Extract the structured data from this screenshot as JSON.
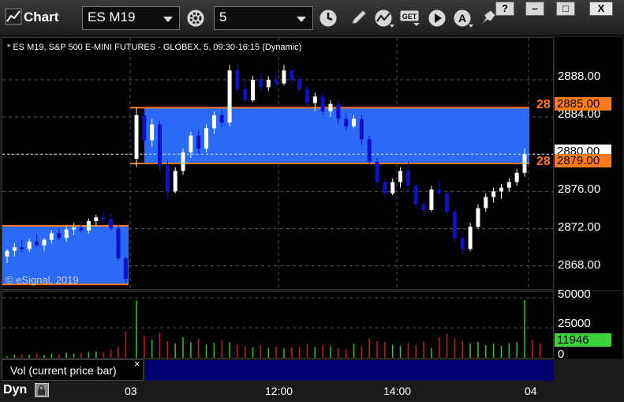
{
  "window": {
    "title": "Chart",
    "symbol": "ES M19",
    "interval": "5",
    "buttons": [
      "?",
      "–",
      "□",
      "X"
    ]
  },
  "chart": {
    "header": "* ES M19, S&P 500 E-MINI FUTURES - GLOBEX, 5, 09:30-16:15 (Dynamic)",
    "copyright": "© eSignal, 2019",
    "price_ticks": [
      "2888.00",
      "2884.00",
      "2880.00",
      "2876.00",
      "2872.00",
      "2868.00"
    ],
    "tags": {
      "upper_level": "2885.00",
      "last_price": "2880.00",
      "lower_level": "2879.00",
      "upper_partial": "28",
      "lower_partial": "28"
    },
    "volume_ticks": [
      "50000",
      "25000",
      "0"
    ],
    "volume_tag": "11946",
    "volume_label": "Vol (current price bar)",
    "close_x": "×",
    "time_ticks": [
      "03",
      "12:00",
      "14:00",
      "04"
    ],
    "mode": "Dyn",
    "colors": {
      "zone": "#2a6af5",
      "level": "#ff7a1a",
      "up": "#ffffff",
      "down": "#1010c8",
      "vol_up": "#2cc92c",
      "vol_down": "#c81e1e"
    },
    "chart_data": {
      "type": "candlestick",
      "title": "* ES M19, S&P 500 E-MINI FUTURES - GLOBEX, 5, 09:30-16:15 (Dynamic)",
      "ylim": [
        2865.5,
        2892.5
      ],
      "zones": [
        {
          "low": 2866.0,
          "high": 2872.3
        },
        {
          "low": 2879.0,
          "high": 2885.0
        }
      ],
      "last_price": 2880.0,
      "candles": [
        {
          "o": 2869.0,
          "h": 2869.8,
          "l": 2868.3,
          "c": 2869.6
        },
        {
          "o": 2869.6,
          "h": 2870.4,
          "l": 2869.0,
          "c": 2870.0
        },
        {
          "o": 2870.0,
          "h": 2870.8,
          "l": 2869.4,
          "c": 2869.8
        },
        {
          "o": 2869.8,
          "h": 2870.9,
          "l": 2869.5,
          "c": 2870.6
        },
        {
          "o": 2870.6,
          "h": 2871.4,
          "l": 2870.0,
          "c": 2870.2
        },
        {
          "o": 2870.2,
          "h": 2871.0,
          "l": 2869.6,
          "c": 2870.8
        },
        {
          "o": 2870.8,
          "h": 2871.8,
          "l": 2870.4,
          "c": 2871.5
        },
        {
          "o": 2871.5,
          "h": 2872.0,
          "l": 2870.8,
          "c": 2871.0
        },
        {
          "o": 2871.0,
          "h": 2872.2,
          "l": 2870.6,
          "c": 2871.9
        },
        {
          "o": 2871.9,
          "h": 2872.6,
          "l": 2871.3,
          "c": 2872.1
        },
        {
          "o": 2872.1,
          "h": 2872.7,
          "l": 2871.6,
          "c": 2871.8
        },
        {
          "o": 2871.8,
          "h": 2873.1,
          "l": 2871.5,
          "c": 2872.8
        },
        {
          "o": 2872.8,
          "h": 2873.5,
          "l": 2872.2,
          "c": 2873.2
        },
        {
          "o": 2873.2,
          "h": 2873.8,
          "l": 2872.6,
          "c": 2873.0
        },
        {
          "o": 2873.0,
          "h": 2873.6,
          "l": 2871.8,
          "c": 2872.0
        },
        {
          "o": 2872.0,
          "h": 2872.4,
          "l": 2868.5,
          "c": 2868.8
        },
        {
          "o": 2868.8,
          "h": 2869.0,
          "l": 2866.2,
          "c": 2866.6
        },
        {
          "o": 2879.5,
          "h": 2885.0,
          "l": 2878.6,
          "c": 2884.2
        },
        {
          "o": 2884.2,
          "h": 2884.6,
          "l": 2881.0,
          "c": 2881.5
        },
        {
          "o": 2881.5,
          "h": 2883.8,
          "l": 2880.8,
          "c": 2883.2
        },
        {
          "o": 2883.2,
          "h": 2883.6,
          "l": 2878.2,
          "c": 2878.8
        },
        {
          "o": 2878.8,
          "h": 2879.4,
          "l": 2875.2,
          "c": 2876.0
        },
        {
          "o": 2876.0,
          "h": 2878.6,
          "l": 2875.8,
          "c": 2878.2
        },
        {
          "o": 2878.2,
          "h": 2880.6,
          "l": 2877.8,
          "c": 2880.2
        },
        {
          "o": 2880.2,
          "h": 2882.4,
          "l": 2879.6,
          "c": 2882.0
        },
        {
          "o": 2882.0,
          "h": 2882.6,
          "l": 2880.0,
          "c": 2880.6
        },
        {
          "o": 2880.6,
          "h": 2883.2,
          "l": 2880.2,
          "c": 2882.8
        },
        {
          "o": 2882.8,
          "h": 2884.6,
          "l": 2882.2,
          "c": 2884.2
        },
        {
          "o": 2884.2,
          "h": 2884.8,
          "l": 2883.0,
          "c": 2883.4
        },
        {
          "o": 2883.4,
          "h": 2889.6,
          "l": 2883.0,
          "c": 2889.0
        },
        {
          "o": 2889.0,
          "h": 2889.8,
          "l": 2886.6,
          "c": 2887.0
        },
        {
          "o": 2887.0,
          "h": 2887.8,
          "l": 2885.4,
          "c": 2885.8
        },
        {
          "o": 2885.8,
          "h": 2888.4,
          "l": 2885.6,
          "c": 2888.0
        },
        {
          "o": 2888.0,
          "h": 2888.6,
          "l": 2886.8,
          "c": 2887.2
        },
        {
          "o": 2887.2,
          "h": 2888.4,
          "l": 2886.8,
          "c": 2888.0
        },
        {
          "o": 2888.0,
          "h": 2888.8,
          "l": 2887.2,
          "c": 2887.6
        },
        {
          "o": 2887.6,
          "h": 2889.6,
          "l": 2887.4,
          "c": 2889.0
        },
        {
          "o": 2889.0,
          "h": 2889.4,
          "l": 2887.6,
          "c": 2888.0
        },
        {
          "o": 2888.0,
          "h": 2888.4,
          "l": 2886.6,
          "c": 2887.0
        },
        {
          "o": 2887.0,
          "h": 2887.4,
          "l": 2885.0,
          "c": 2885.5
        },
        {
          "o": 2885.5,
          "h": 2886.6,
          "l": 2884.6,
          "c": 2886.2
        },
        {
          "o": 2886.2,
          "h": 2886.8,
          "l": 2884.2,
          "c": 2884.6
        },
        {
          "o": 2884.6,
          "h": 2885.8,
          "l": 2884.0,
          "c": 2885.4
        },
        {
          "o": 2885.4,
          "h": 2885.8,
          "l": 2883.2,
          "c": 2883.8
        },
        {
          "o": 2883.8,
          "h": 2884.4,
          "l": 2882.6,
          "c": 2883.0
        },
        {
          "o": 2883.0,
          "h": 2884.2,
          "l": 2882.8,
          "c": 2883.8
        },
        {
          "o": 2883.8,
          "h": 2884.2,
          "l": 2881.0,
          "c": 2881.6
        },
        {
          "o": 2881.6,
          "h": 2882.0,
          "l": 2878.8,
          "c": 2879.2
        },
        {
          "o": 2879.2,
          "h": 2879.6,
          "l": 2876.4,
          "c": 2877.0
        },
        {
          "o": 2877.0,
          "h": 2877.4,
          "l": 2875.2,
          "c": 2875.8
        },
        {
          "o": 2875.8,
          "h": 2877.4,
          "l": 2875.6,
          "c": 2877.0
        },
        {
          "o": 2877.0,
          "h": 2878.6,
          "l": 2876.4,
          "c": 2878.2
        },
        {
          "o": 2878.2,
          "h": 2879.2,
          "l": 2876.0,
          "c": 2876.6
        },
        {
          "o": 2876.6,
          "h": 2877.0,
          "l": 2874.2,
          "c": 2874.6
        },
        {
          "o": 2874.6,
          "h": 2875.2,
          "l": 2873.4,
          "c": 2874.0
        },
        {
          "o": 2874.0,
          "h": 2876.6,
          "l": 2873.8,
          "c": 2876.2
        },
        {
          "o": 2876.2,
          "h": 2877.2,
          "l": 2875.4,
          "c": 2875.8
        },
        {
          "o": 2875.8,
          "h": 2876.2,
          "l": 2873.4,
          "c": 2873.8
        },
        {
          "o": 2873.8,
          "h": 2874.2,
          "l": 2870.6,
          "c": 2871.0
        },
        {
          "o": 2871.0,
          "h": 2871.6,
          "l": 2869.2,
          "c": 2869.8
        },
        {
          "o": 2869.8,
          "h": 2872.6,
          "l": 2869.6,
          "c": 2872.2
        },
        {
          "o": 2872.2,
          "h": 2874.6,
          "l": 2872.0,
          "c": 2874.2
        },
        {
          "o": 2874.2,
          "h": 2875.8,
          "l": 2873.8,
          "c": 2875.4
        },
        {
          "o": 2875.4,
          "h": 2876.4,
          "l": 2874.8,
          "c": 2876.0
        },
        {
          "o": 2876.0,
          "h": 2876.8,
          "l": 2875.2,
          "c": 2876.4
        },
        {
          "o": 2876.4,
          "h": 2877.4,
          "l": 2876.0,
          "c": 2877.0
        },
        {
          "o": 2877.0,
          "h": 2878.4,
          "l": 2876.6,
          "c": 2878.0
        },
        {
          "o": 2878.0,
          "h": 2880.6,
          "l": 2877.6,
          "c": 2880.0
        }
      ],
      "volume": [
        1200,
        2500,
        3000,
        2400,
        3800,
        2200,
        3500,
        2800,
        4200,
        3600,
        3900,
        4800,
        5200,
        4500,
        6800,
        9500,
        22000,
        48000,
        18000,
        15000,
        21000,
        14000,
        12000,
        17000,
        13000,
        16000,
        11000,
        12500,
        14500,
        13000,
        11000,
        9800,
        8800,
        10500,
        8200,
        9200,
        7800,
        8500,
        9200,
        11000,
        8900,
        10800,
        9600,
        8000,
        7200,
        11800,
        9500,
        16000,
        14000,
        13000,
        11000,
        9800,
        12500,
        10500,
        13500,
        8200,
        17000,
        20000,
        16000,
        13800,
        12000,
        13200,
        10500,
        11800,
        9800,
        12000,
        13200,
        48000,
        15000,
        11946
      ]
    }
  }
}
